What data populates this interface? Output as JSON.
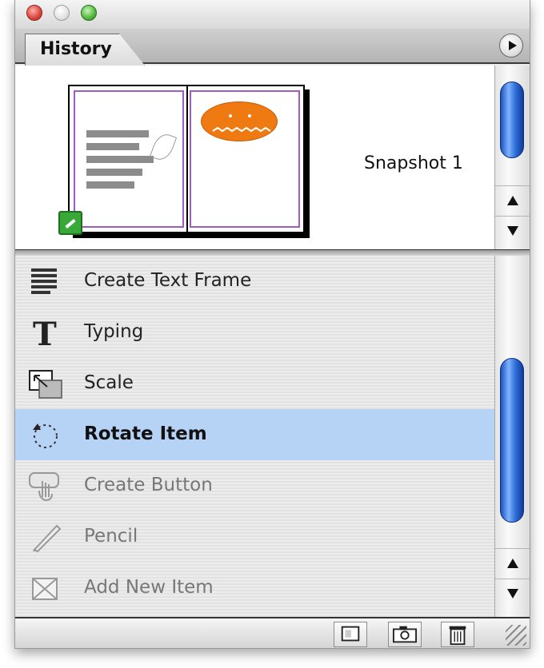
{
  "window": {
    "tab_label": "History"
  },
  "snapshot": {
    "label": "Snapshot 1",
    "egg_color": "#f07a12",
    "page_border_color": "#a05cc6"
  },
  "history_items": [
    {
      "label": "Create Text Frame",
      "icon": "text-frame-icon",
      "state": "past"
    },
    {
      "label": "Typing",
      "icon": "type-tool-icon",
      "state": "past"
    },
    {
      "label": "Scale",
      "icon": "scale-icon",
      "state": "past"
    },
    {
      "label": "Rotate Item",
      "icon": "rotate-icon",
      "state": "current"
    },
    {
      "label": "Create Button",
      "icon": "button-tool-icon",
      "state": "future"
    },
    {
      "label": "Pencil",
      "icon": "pencil-icon",
      "state": "future"
    },
    {
      "label": "Add New Item",
      "icon": "add-item-icon",
      "state": "future"
    }
  ],
  "toolbar": {
    "buttons": [
      "new-document-from-state-icon",
      "camera-icon",
      "trash-icon"
    ]
  },
  "colors": {
    "selection": "#b6d3f6",
    "scroll_thumb": "#2f6fd8"
  }
}
